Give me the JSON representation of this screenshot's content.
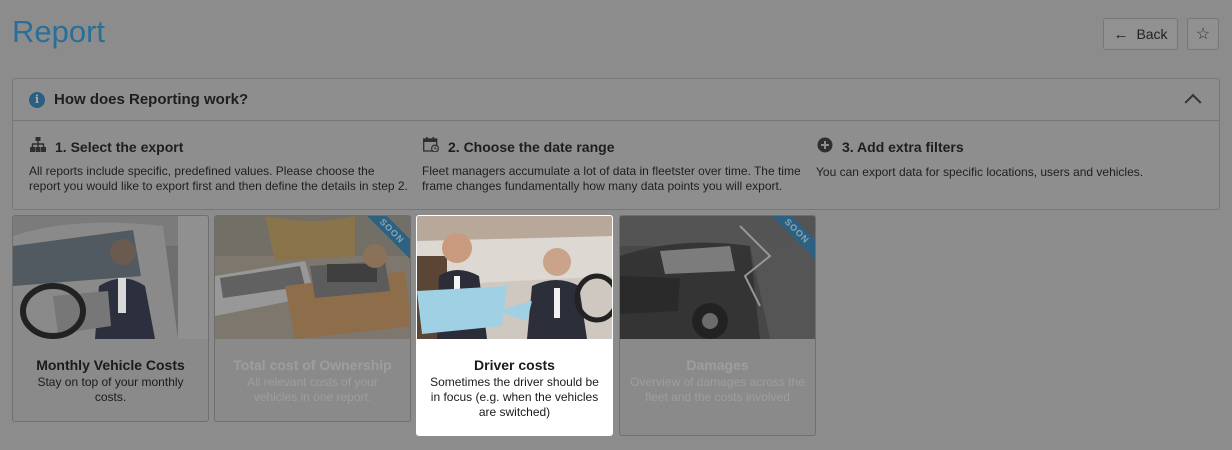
{
  "page": {
    "title": "Report"
  },
  "toolbar": {
    "back_label": "Back",
    "back_icon": "arrow-left-icon",
    "star_icon": "star-icon"
  },
  "info_panel": {
    "title": "How does Reporting work?",
    "steps": [
      {
        "icon": "sitemap-icon",
        "title": "1. Select the export",
        "description": "All reports include specific, predefined values. Please choose the report you would like to export first and then define the details in step 2."
      },
      {
        "icon": "calendar-icon",
        "title": "2. Choose the date range",
        "description": "Fleet managers accumulate a lot of data in fleetster over time. The time frame changes fundamentally how many data points you will export."
      },
      {
        "icon": "plus-circle-icon",
        "title": "3. Add extra filters",
        "description": "You can export data for specific locations, users and vehicles."
      }
    ]
  },
  "reports": [
    {
      "title": "Monthly Vehicle Costs",
      "description": "Stay on top of your monthly costs.",
      "state": "available",
      "badge": ""
    },
    {
      "title": "Total cost of Ownership",
      "description": "All relevant costs of your vehicles in one report.",
      "state": "coming-soon",
      "badge": "SOON"
    },
    {
      "title": "Driver costs",
      "description": "Sometimes the driver should be in focus (e.g. when the vehicles are switched)",
      "state": "selected",
      "badge": ""
    },
    {
      "title": "Damages",
      "description": "Overview of damages across the fleet and the costs involved",
      "state": "coming-soon",
      "badge": "SOON"
    }
  ],
  "colors": {
    "title_blue": "#2a6f99",
    "ribbon_blue": "#1d5a80",
    "overlay_gray": "#8c8c8c"
  }
}
